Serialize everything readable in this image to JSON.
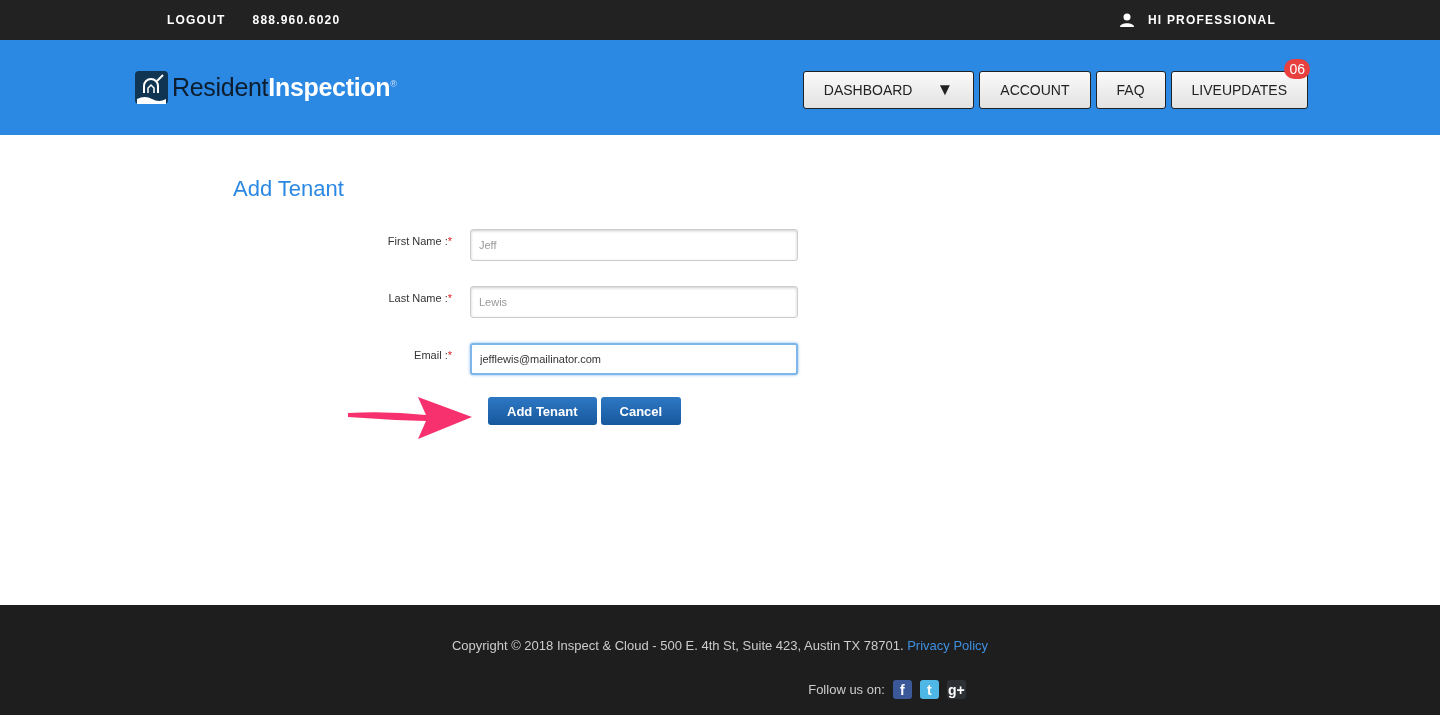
{
  "top_bar": {
    "links": [
      "LOGOUT",
      "888.960.6020"
    ],
    "greeting": "HI PROFESSIONAL"
  },
  "header": {
    "logo": {
      "part_1": "Resident",
      "part_2": "Inspection",
      "mark": "®"
    },
    "nav": [
      {
        "label": "DASHBOARD",
        "kind": "dropdown",
        "caret": "▼"
      },
      {
        "label": "ACCOUNT",
        "kind": "plain"
      },
      {
        "label": "FAQ",
        "kind": "plain"
      },
      {
        "label": "LIVEUPDATES",
        "kind": "badge",
        "badge": "06"
      }
    ]
  },
  "form": {
    "title": "Add Tenant",
    "fields": [
      {
        "label": "First Name :",
        "required": "*",
        "placeholder": "Jeff",
        "focused": false
      },
      {
        "label": "Last Name :",
        "required": "*",
        "placeholder": "Lewis",
        "focused": false
      },
      {
        "label": "Email :",
        "required": "*",
        "value": "jefflewis@mailinator.com",
        "focused": true
      }
    ],
    "buttons": [
      "Add Tenant",
      "Cancel"
    ]
  },
  "footer": {
    "copyright": "Copyright © 2018 Inspect & Cloud - 500 E. 4th St, Suite 423, Austin TX 78701.",
    "link": "Privacy Policy",
    "follow": "Follow us on:",
    "social": [
      {
        "kind": "facebook",
        "glyph": "f"
      },
      {
        "kind": "twitter",
        "glyph": "t"
      },
      {
        "kind": "googleplus",
        "glyph": "g+"
      }
    ]
  }
}
